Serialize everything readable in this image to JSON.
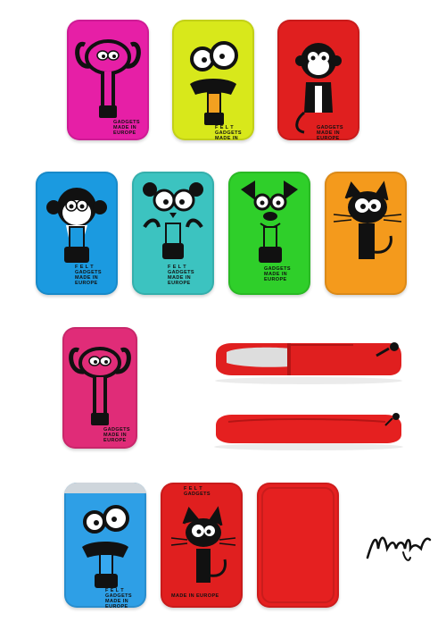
{
  "product": {
    "print_line1": "F E L T",
    "print_line2": "GADGETS",
    "print_line3": "MADE IN EUROPE"
  },
  "pouches": [
    {
      "color": "#e61fa6",
      "animal": "elephant"
    },
    {
      "color": "#d8e81b",
      "animal": "frog"
    },
    {
      "color": "#e01f1f",
      "animal": "monkey"
    },
    {
      "color": "#1b9ae0",
      "animal": "monkey"
    },
    {
      "color": "#3cc3c0",
      "animal": "bear"
    },
    {
      "color": "#2fcf2a",
      "animal": "dog"
    },
    {
      "color": "#f49a1c",
      "animal": "cat"
    },
    {
      "color": "#e02c78",
      "animal": "elephant"
    },
    {
      "color": "#2e9fe6",
      "animal": "frog"
    },
    {
      "color": "#e01f1f",
      "animal": "cat"
    },
    {
      "color": "#e52020",
      "animal": "plain-back"
    }
  ],
  "signature": {
    "style": "handwritten"
  }
}
